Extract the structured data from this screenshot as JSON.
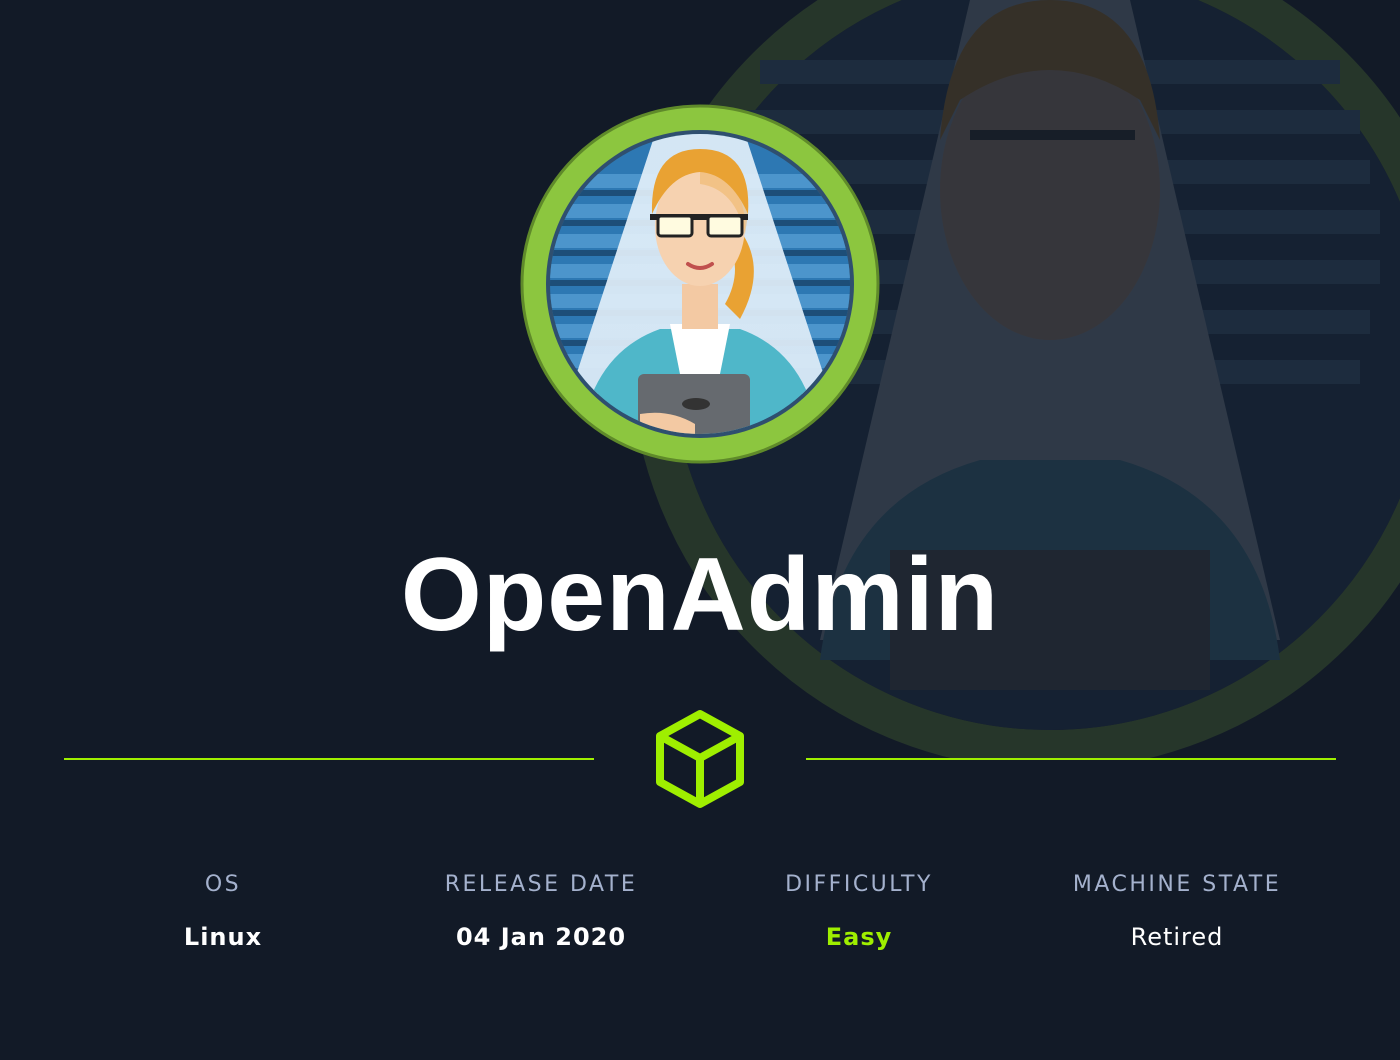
{
  "machine": {
    "name": "OpenAdmin"
  },
  "stats": [
    {
      "label": "OS",
      "value": "Linux"
    },
    {
      "label": "RELEASE DATE",
      "value": "04 Jan 2020"
    },
    {
      "label": "DIFFICULTY",
      "value": "Easy"
    },
    {
      "label": "MACHINE STATE",
      "value": "Retired"
    }
  ],
  "colors": {
    "background": "#121a27",
    "accent": "#9fef00",
    "avatar_ring": "#8cc63f",
    "label": "#a4b1cd",
    "text": "#ffffff"
  },
  "icons": {
    "divider_icon": "hackthebox-cube-icon",
    "avatar": "admin-avatar-illustration"
  }
}
